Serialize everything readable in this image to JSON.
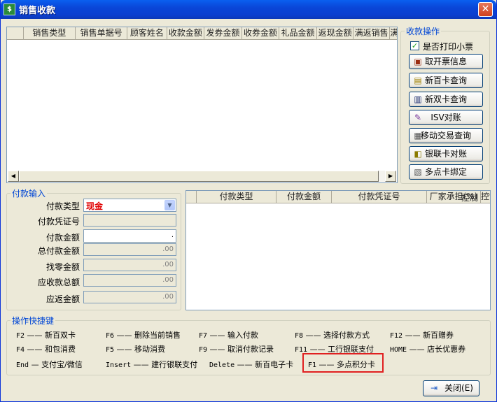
{
  "window": {
    "title": "销售收款",
    "close_glyph": "✕"
  },
  "sales_table": {
    "columns": [
      "",
      "销售类型",
      "销售单据号",
      "顾客姓名",
      "收款金额",
      "发券金额",
      "收券金额",
      "礼品金额",
      "返现金额",
      "满返销售",
      "满"
    ],
    "scroll_left": "◀",
    "scroll_right": "▶"
  },
  "ops": {
    "legend": "收款操作",
    "print_receipt": {
      "label": "是否打印小票",
      "checked": true,
      "mark": "✓"
    },
    "buttons": [
      {
        "label": "取开票信息",
        "icon": "invoice-icon",
        "glyph": "▣"
      },
      {
        "label": "新百卡查询",
        "icon": "card-query-icon",
        "glyph": "▤"
      },
      {
        "label": "新双卡查询",
        "icon": "dual-card-icon",
        "glyph": "▥"
      },
      {
        "label": "ISV对账",
        "icon": "reconcile-icon",
        "glyph": "✎"
      },
      {
        "label": "移动交易查询",
        "icon": "mobile-trade-icon",
        "glyph": "▦"
      },
      {
        "label": "银联卡对账",
        "icon": "unionpay-icon",
        "glyph": "◧"
      },
      {
        "label": "多点卡绑定",
        "icon": "bind-card-icon",
        "glyph": "▧"
      }
    ]
  },
  "payment": {
    "legend": "付款输入",
    "type_label": "付款类型",
    "type_value": "现金",
    "voucher_label": "付款凭证号",
    "voucher_value": "",
    "amount_label": "付款金额",
    "amount_value": ".",
    "total_label": "总付款金额",
    "total_value": ".00",
    "change_label": "找零金额",
    "change_value": ".00",
    "receivable_label": "应收款总额",
    "receivable_value": ".00",
    "refund_label": "应返金额",
    "refund_value": ".00"
  },
  "payment_table": {
    "columns": [
      "",
      "付款类型",
      "付款金额",
      "付款凭证号",
      "厂家承担(%)",
      "控制"
    ]
  },
  "shortcuts": {
    "legend": "操作快捷键",
    "items": [
      {
        "key": "F2",
        "label": "新百双卡"
      },
      {
        "key": "F6",
        "label": "删除当前销售"
      },
      {
        "key": "F7",
        "label": "输入付款"
      },
      {
        "key": "F8",
        "label": "选择付款方式"
      },
      {
        "key": "F12",
        "label": "新百赠券"
      },
      {
        "key": "F4",
        "label": "和包消费"
      },
      {
        "key": "F5",
        "label": "移动消费"
      },
      {
        "key": "F9",
        "label": "取消付款记录"
      },
      {
        "key": "F11",
        "label": "工行银联支付"
      },
      {
        "key": "HOME",
        "label": "店长优惠券"
      },
      {
        "key": "End",
        "label": "支付宝/微信"
      },
      {
        "key": "Insert",
        "label": "建行银联支付"
      },
      {
        "key": "Delete",
        "label": "新百电子卡"
      },
      {
        "key": "F1",
        "label": "多点积分卡"
      }
    ],
    "sep_long": "——",
    "sep_short": "—"
  },
  "close_button": {
    "label": "关闭(E)",
    "icon": "exit-icon",
    "glyph": "⇥"
  },
  "colors": {
    "title_bar": "#0a46d8",
    "legend": "#0046d5",
    "payment_type_value": "#e00000",
    "highlight": "#e02020"
  }
}
